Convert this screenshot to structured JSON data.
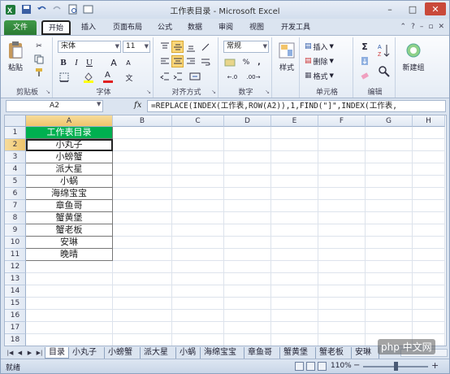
{
  "window": {
    "title": "工作表目录 - Microsoft Excel"
  },
  "ribbon_tabs": [
    "文件",
    "开始",
    "插入",
    "页面布局",
    "公式",
    "数据",
    "审阅",
    "视图",
    "开发工具"
  ],
  "clipboard": {
    "paste": "粘贴",
    "label": "剪贴板"
  },
  "font": {
    "name": "宋体",
    "size": "11",
    "label": "字体",
    "bold": "B",
    "italic": "I",
    "underline": "U",
    "grow": "A",
    "shrink": "A",
    "color_letter": "A",
    "wen": "文"
  },
  "alignment": {
    "label": "对齐方式"
  },
  "number": {
    "format": "常规",
    "percent": "%",
    "comma": ",",
    "label": "数字"
  },
  "styles": {
    "label": "样式"
  },
  "cells_group": {
    "insert": "插入",
    "delete": "删除",
    "format": "格式",
    "label": "单元格"
  },
  "editing": {
    "sigma": "Σ",
    "label": "编辑"
  },
  "newgroup": {
    "label": "新建组"
  },
  "formula_bar": {
    "name_box": "A2",
    "fx": "fx",
    "formula": "=REPLACE(INDEX(工作表,ROW(A2)),1,FIND(\"]\",INDEX(工作表,"
  },
  "columns": [
    "A",
    "B",
    "C",
    "D",
    "E",
    "F",
    "G",
    "H"
  ],
  "rows": [
    "1",
    "2",
    "3",
    "4",
    "5",
    "6",
    "7",
    "8",
    "9",
    "10",
    "11",
    "12",
    "13",
    "14",
    "15",
    "16",
    "17",
    "18"
  ],
  "cells_A": [
    "工作表目录",
    "小丸子",
    "小螃蟹",
    "派大星",
    "小蜗",
    "海绵宝宝",
    "章鱼哥",
    "蟹黄堡",
    "蟹老板",
    "安琳",
    "晚晴"
  ],
  "sheet_tabs": [
    "目录",
    "小丸子",
    "小螃蟹",
    "派大星",
    "小蜗",
    "海绵宝宝",
    "章鱼哥",
    "蟹黄堡",
    "蟹老板",
    "安琳"
  ],
  "status": {
    "ready": "就绪",
    "zoom": "110%",
    "minus": "−",
    "plus": "+"
  },
  "watermark": "php 中文网",
  "colors": {
    "header_fill": "#00b050",
    "file_tab": "#2a7a33",
    "selection": "#fbd77a"
  }
}
